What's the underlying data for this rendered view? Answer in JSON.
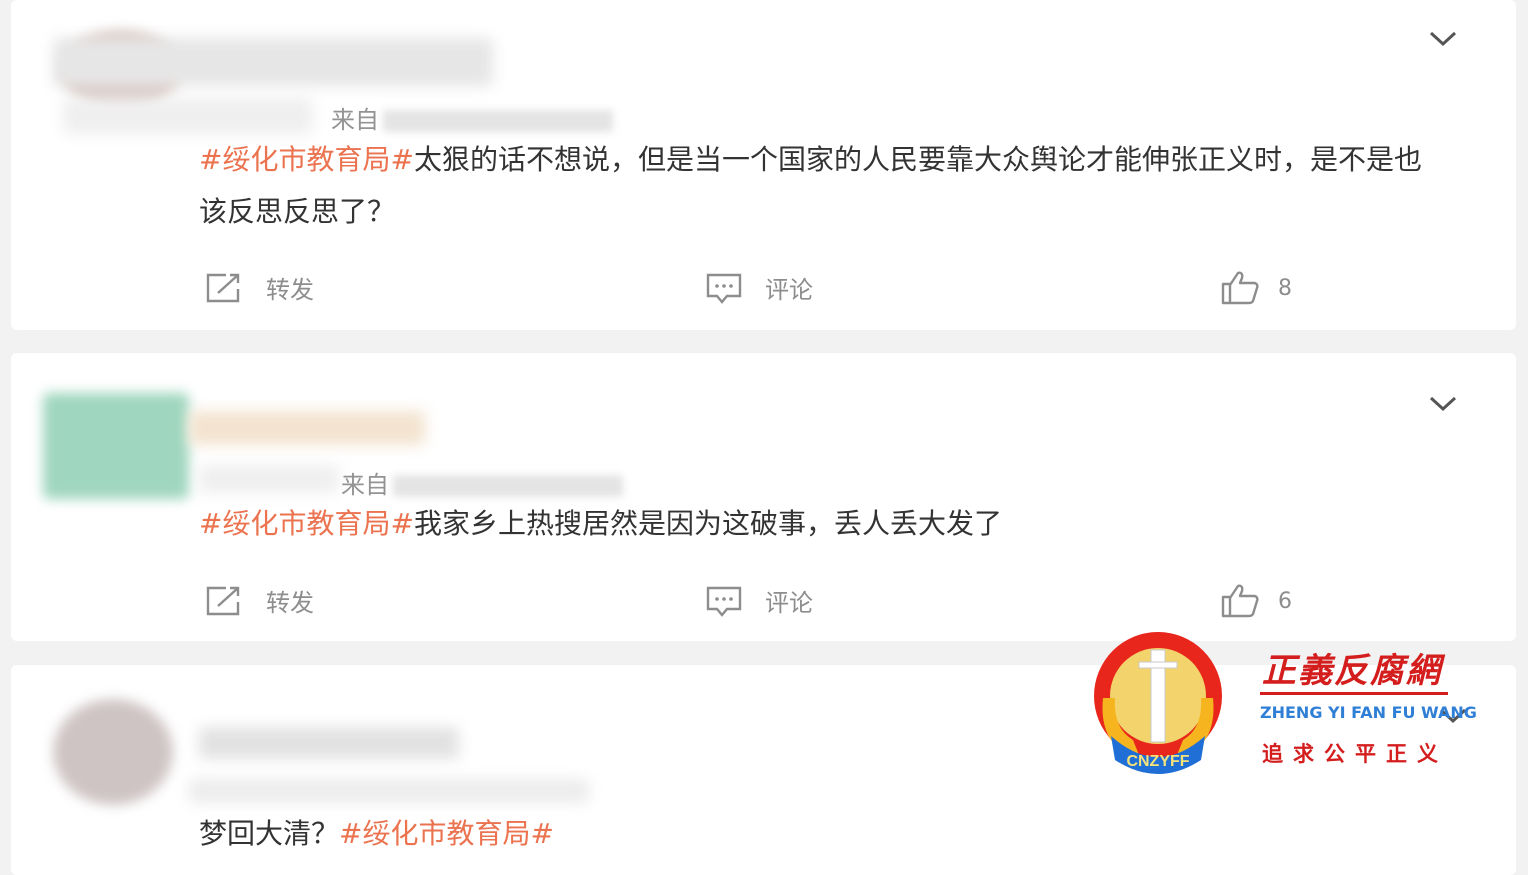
{
  "posts": [
    {
      "source_prefix": "来自",
      "tag": "#绥化市教育局#",
      "text": "太狠的话不想说，但是当一个国家的人民要靠大众舆论才能伸张正义时，是不是也该反思反思了？",
      "actions": {
        "repost": "转发",
        "comment": "评论",
        "likes": "8"
      }
    },
    {
      "source_prefix": "来自",
      "tag": "#绥化市教育局#",
      "text": "我家乡上热搜居然是因为这破事，丢人丢大发了",
      "actions": {
        "repost": "转发",
        "comment": "评论",
        "likes": "6"
      }
    },
    {
      "text_before": "梦回大清？",
      "tag": "#绥化市教育局#"
    }
  ],
  "icons": {
    "repost": "repost-icon",
    "comment": "comment-icon",
    "like": "thumbs-up-icon",
    "menu": "chevron-down-icon"
  },
  "watermark": {
    "title": "正義反腐網",
    "pinyin": "ZHENG YI FAN FU WANG",
    "slogan": "追求公平正义",
    "emblem_text": "CNZYFF"
  },
  "colors": {
    "tag": "#eb7350",
    "text": "#333333",
    "muted": "#8d8d8d",
    "watermark_red": "#d41e1e",
    "watermark_blue": "#2f7fd6"
  }
}
